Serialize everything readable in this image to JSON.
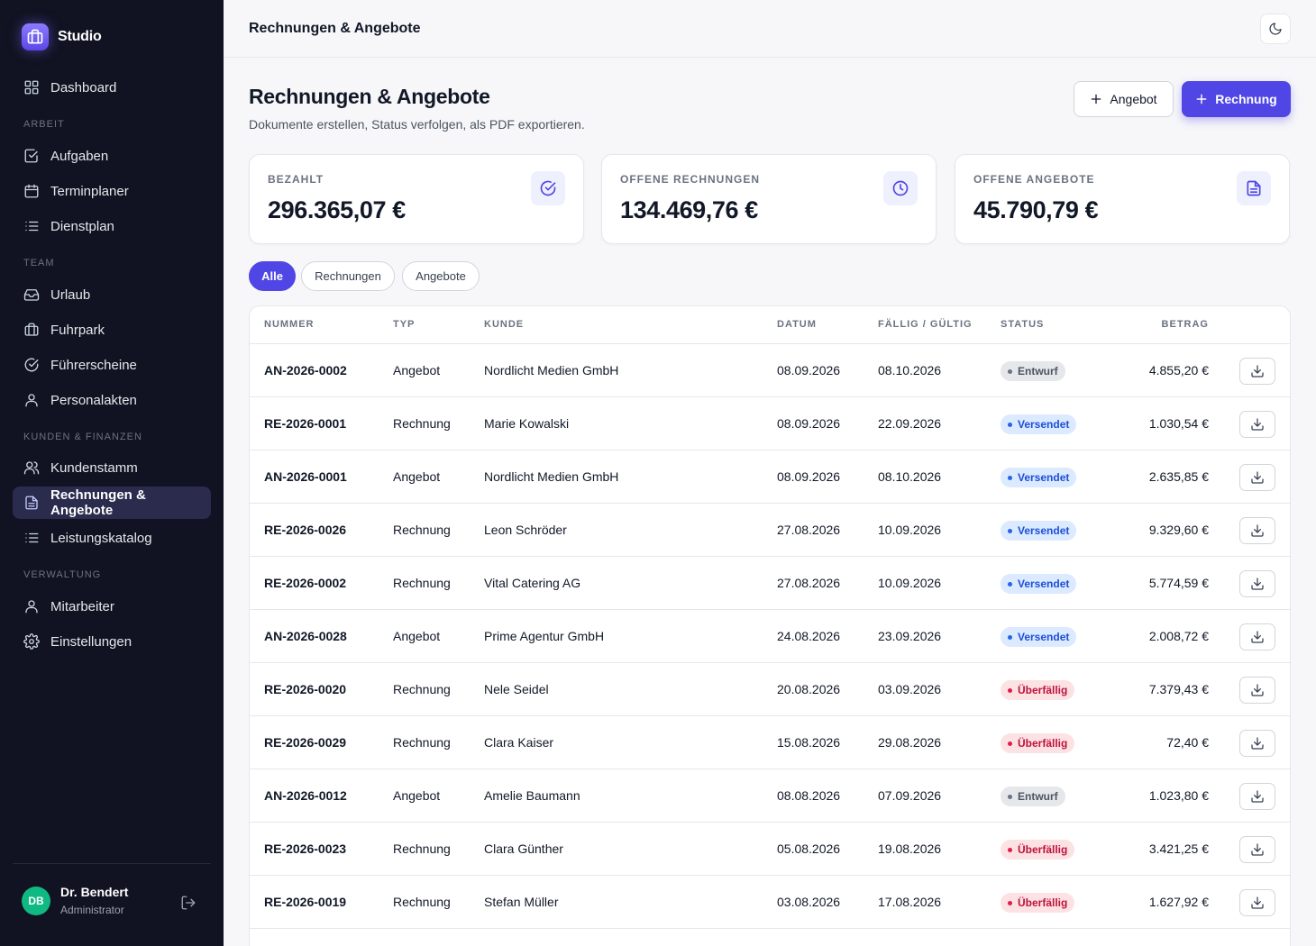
{
  "brand": {
    "name": "Studio"
  },
  "sidebar": {
    "dashboard": "Dashboard",
    "sections": {
      "arbeit": "ARBEIT",
      "team": "TEAM",
      "kunden": "KUNDEN & FINANZEN",
      "verwaltung": "VERWALTUNG"
    },
    "items": {
      "aufgaben": "Aufgaben",
      "terminplaner": "Terminplaner",
      "dienstplan": "Dienstplan",
      "urlaub": "Urlaub",
      "fuhrpark": "Fuhrpark",
      "fuehrerscheine": "Führerscheine",
      "personalakten": "Personalakten",
      "kundenstamm": "Kundenstamm",
      "rechnungen": "Rechnungen & Angebote",
      "leistungskatalog": "Leistungskatalog",
      "mitarbeiter": "Mitarbeiter",
      "einstellungen": "Einstellungen"
    },
    "active": "rechnungen"
  },
  "user": {
    "initials": "DB",
    "name": "Dr. Bendert",
    "role": "Administrator"
  },
  "topbar": {
    "title": "Rechnungen & Angebote"
  },
  "header": {
    "title": "Rechnungen & Angebote",
    "subtitle": "Dokumente erstellen, Status verfolgen, als PDF exportieren.",
    "btn_angebot": "Angebot",
    "btn_rechnung": "Rechnung"
  },
  "stats": [
    {
      "label": "BEZAHLT",
      "value": "296.365,07 €",
      "icon": "check-circle-icon"
    },
    {
      "label": "OFFENE RECHNUNGEN",
      "value": "134.469,76 €",
      "icon": "clock-icon"
    },
    {
      "label": "OFFENE ANGEBOTE",
      "value": "45.790,79 €",
      "icon": "document-icon"
    }
  ],
  "filters": {
    "alle": "Alle",
    "rechnungen": "Rechnungen",
    "angebote": "Angebote",
    "active": "alle"
  },
  "table": {
    "headers": {
      "nummer": "NUMMER",
      "typ": "TYP",
      "kunde": "KUNDE",
      "datum": "DATUM",
      "faellig": "FÄLLIG / GÜLTIG",
      "status": "STATUS",
      "betrag": "BETRAG"
    },
    "rows": [
      {
        "nummer": "AN-2026-0002",
        "typ": "Angebot",
        "kunde": "Nordlicht Medien GmbH",
        "datum": "08.09.2026",
        "faellig": "08.10.2026",
        "status": "Entwurf",
        "status_kind": "draft",
        "betrag": "4.855,20 €"
      },
      {
        "nummer": "RE-2026-0001",
        "typ": "Rechnung",
        "kunde": "Marie Kowalski",
        "datum": "08.09.2026",
        "faellig": "22.09.2026",
        "status": "Versendet",
        "status_kind": "sent",
        "betrag": "1.030,54 €"
      },
      {
        "nummer": "AN-2026-0001",
        "typ": "Angebot",
        "kunde": "Nordlicht Medien GmbH",
        "datum": "08.09.2026",
        "faellig": "08.10.2026",
        "status": "Versendet",
        "status_kind": "sent",
        "betrag": "2.635,85 €"
      },
      {
        "nummer": "RE-2026-0026",
        "typ": "Rechnung",
        "kunde": "Leon Schröder",
        "datum": "27.08.2026",
        "faellig": "10.09.2026",
        "status": "Versendet",
        "status_kind": "sent",
        "betrag": "9.329,60 €"
      },
      {
        "nummer": "RE-2026-0002",
        "typ": "Rechnung",
        "kunde": "Vital Catering AG",
        "datum": "27.08.2026",
        "faellig": "10.09.2026",
        "status": "Versendet",
        "status_kind": "sent",
        "betrag": "5.774,59 €"
      },
      {
        "nummer": "AN-2026-0028",
        "typ": "Angebot",
        "kunde": "Prime Agentur GmbH",
        "datum": "24.08.2026",
        "faellig": "23.09.2026",
        "status": "Versendet",
        "status_kind": "sent",
        "betrag": "2.008,72 €"
      },
      {
        "nummer": "RE-2026-0020",
        "typ": "Rechnung",
        "kunde": "Nele Seidel",
        "datum": "20.08.2026",
        "faellig": "03.09.2026",
        "status": "Überfällig",
        "status_kind": "overdue",
        "betrag": "7.379,43 €"
      },
      {
        "nummer": "RE-2026-0029",
        "typ": "Rechnung",
        "kunde": "Clara Kaiser",
        "datum": "15.08.2026",
        "faellig": "29.08.2026",
        "status": "Überfällig",
        "status_kind": "overdue",
        "betrag": "72,40 €"
      },
      {
        "nummer": "AN-2026-0012",
        "typ": "Angebot",
        "kunde": "Amelie Baumann",
        "datum": "08.08.2026",
        "faellig": "07.09.2026",
        "status": "Entwurf",
        "status_kind": "draft",
        "betrag": "1.023,80 €"
      },
      {
        "nummer": "RE-2026-0023",
        "typ": "Rechnung",
        "kunde": "Clara Günther",
        "datum": "05.08.2026",
        "faellig": "19.08.2026",
        "status": "Überfällig",
        "status_kind": "overdue",
        "betrag": "3.421,25 €"
      },
      {
        "nummer": "RE-2026-0019",
        "typ": "Rechnung",
        "kunde": "Stefan Müller",
        "datum": "03.08.2026",
        "faellig": "17.08.2026",
        "status": "Überfällig",
        "status_kind": "overdue",
        "betrag": "1.627,92 €"
      }
    ]
  },
  "colors": {
    "accent": "#4f46e5",
    "sidebar_bg": "#111322",
    "avatar": "#10b981"
  }
}
